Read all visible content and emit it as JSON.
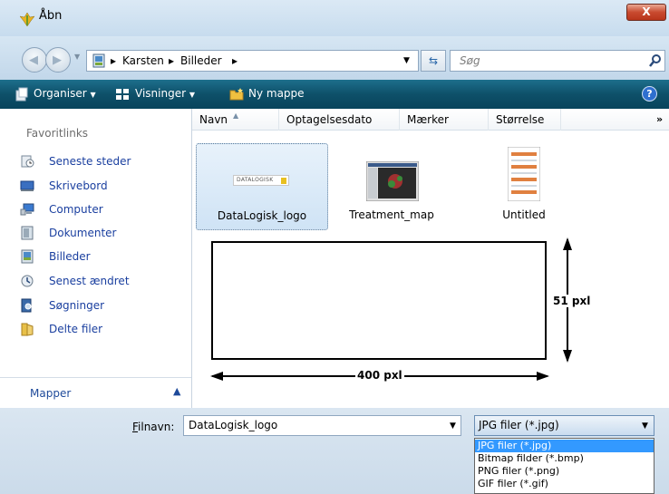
{
  "window": {
    "title": "Åbn",
    "close_label": "X"
  },
  "navigation": {
    "breadcrumbs": [
      "Karsten",
      "Billeder"
    ],
    "search_placeholder": "Søg"
  },
  "toolbar": {
    "organize_label": "Organiser",
    "views_label": "Visninger",
    "new_folder_label": "Ny mappe"
  },
  "sidebar": {
    "heading": "Favoritlinks",
    "items": [
      {
        "label": "Seneste steder",
        "icon": "recent-places-icon"
      },
      {
        "label": "Skrivebord",
        "icon": "desktop-icon"
      },
      {
        "label": "Computer",
        "icon": "computer-icon"
      },
      {
        "label": "Dokumenter",
        "icon": "documents-icon"
      },
      {
        "label": "Billeder",
        "icon": "pictures-icon"
      },
      {
        "label": "Senest ændret",
        "icon": "recently-changed-icon"
      },
      {
        "label": "Søgninger",
        "icon": "searches-icon"
      },
      {
        "label": "Delte filer",
        "icon": "shared-folder-icon"
      }
    ],
    "folders_label": "Mapper"
  },
  "columns": [
    "Navn",
    "Optagelsesdato",
    "Mærker",
    "Størrelse"
  ],
  "files": [
    {
      "name": "DataLogisk_logo",
      "thumb_text": "DATALOGISK",
      "selected": true
    },
    {
      "name": "Treatment_map",
      "selected": false
    },
    {
      "name": "Untitled",
      "selected": false
    }
  ],
  "dimensions": {
    "width_label": "400 pxl",
    "height_label": "51 pxl"
  },
  "bottom": {
    "filename_label": "Filnavn:",
    "filename_value": "DataLogisk_logo",
    "filetype_selected": "JPG filer (*.jpg)",
    "filetype_options": [
      "JPG filer (*.jpg)",
      "Bitmap filder (*.bmp)",
      "PNG filer (*.png)",
      "GIF filer (*.gif)"
    ]
  },
  "colors": {
    "toolbar": "#0e5069",
    "link": "#1a3f9f",
    "selection": "#3399ff"
  }
}
